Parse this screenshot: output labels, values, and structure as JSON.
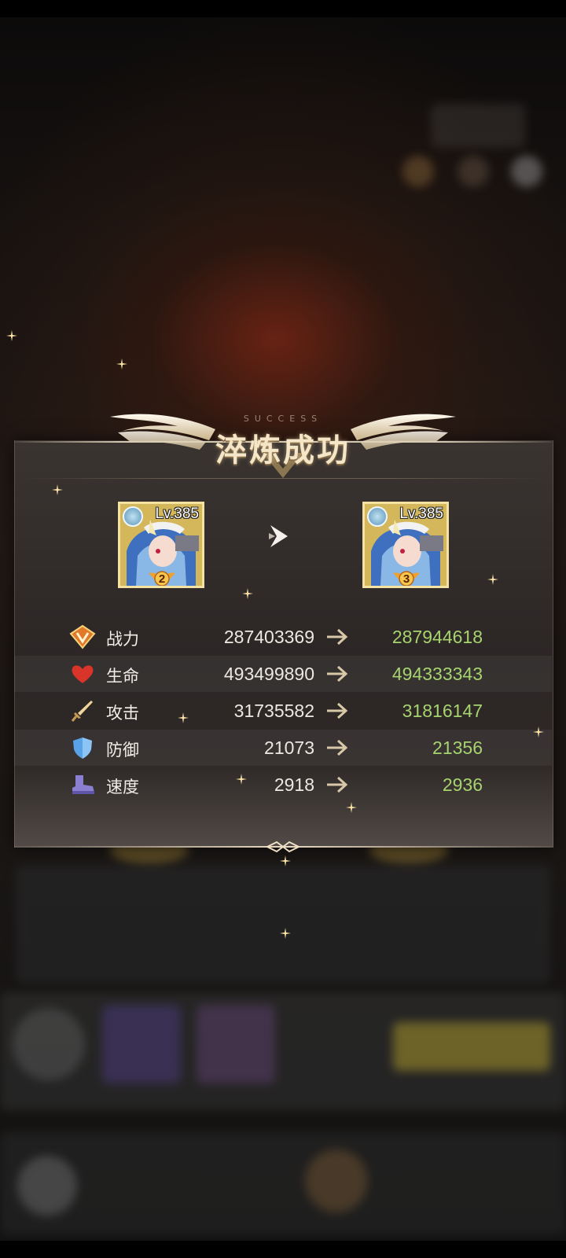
{
  "banner": {
    "subtitle": "SUCCESS",
    "title": "淬炼成功"
  },
  "hero_before": {
    "level_label": "Lv.385",
    "stars": "2"
  },
  "hero_after": {
    "level_label": "Lv.385",
    "stars": "3"
  },
  "stats": [
    {
      "icon": "power-icon",
      "label": "战力",
      "old": "287403369",
      "new": "287944618"
    },
    {
      "icon": "heart-icon",
      "label": "生命",
      "old": "493499890",
      "new": "494333343"
    },
    {
      "icon": "sword-icon",
      "label": "攻击",
      "old": "31735582",
      "new": "31816147"
    },
    {
      "icon": "shield-icon",
      "label": "防御",
      "old": "21073",
      "new": "21356"
    },
    {
      "icon": "boot-icon",
      "label": "速度",
      "old": "2918",
      "new": "2936"
    }
  ],
  "colors": {
    "increase_value": "#a7d36f",
    "card_border": "#f3e2a2",
    "panel_bg": "#2b2625"
  }
}
